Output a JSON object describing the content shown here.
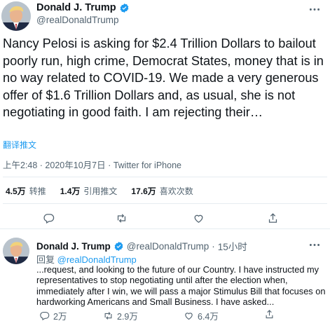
{
  "tweet": {
    "author_name": "Donald J. Trump",
    "author_handle": "@realDonaldTrump",
    "text": "Nancy Pelosi is asking for $2.4 Trillion Dollars to bailout poorly run, high crime, Democrat States, money that is in no way related to COVID-19. We made a very generous offer of $1.6 Trillion Dollars and, as usual, she is not negotiating in good faith. I am rejecting their…",
    "translate_label": "翻译推文",
    "meta": "上午2:48 · 2020年10月7日 · Twitter for iPhone",
    "stats": {
      "retweets_count": "4.5万",
      "retweets_label": "转推",
      "quotes_count": "1.4万",
      "quotes_label": "引用推文",
      "likes_count": "17.6万",
      "likes_label": "喜欢次数"
    }
  },
  "reply": {
    "author_name": "Donald J. Trump",
    "author_handle": "@realDonaldTrump",
    "separator": "·",
    "time": "15小时",
    "reply_prefix": "回复",
    "reply_mention": "@realDonaldTrump",
    "text": "...request, and looking to the future of our Country. I have instructed my representatives to stop negotiating until after the election when, immediately after I win, we will pass a major Stimulus Bill that focuses on hardworking Americans and Small Business. I have asked...",
    "replies": "2万",
    "retweets": "2.9万",
    "likes": "6.4万"
  },
  "icons": {
    "verified": "verified-badge-icon",
    "more": "more-icon",
    "reply": "reply-icon",
    "retweet": "retweet-icon",
    "like": "heart-icon",
    "share": "share-icon"
  },
  "colors": {
    "accent": "#1d9bf0",
    "secondary_text": "#536471",
    "divider": "#e6ecf0"
  }
}
